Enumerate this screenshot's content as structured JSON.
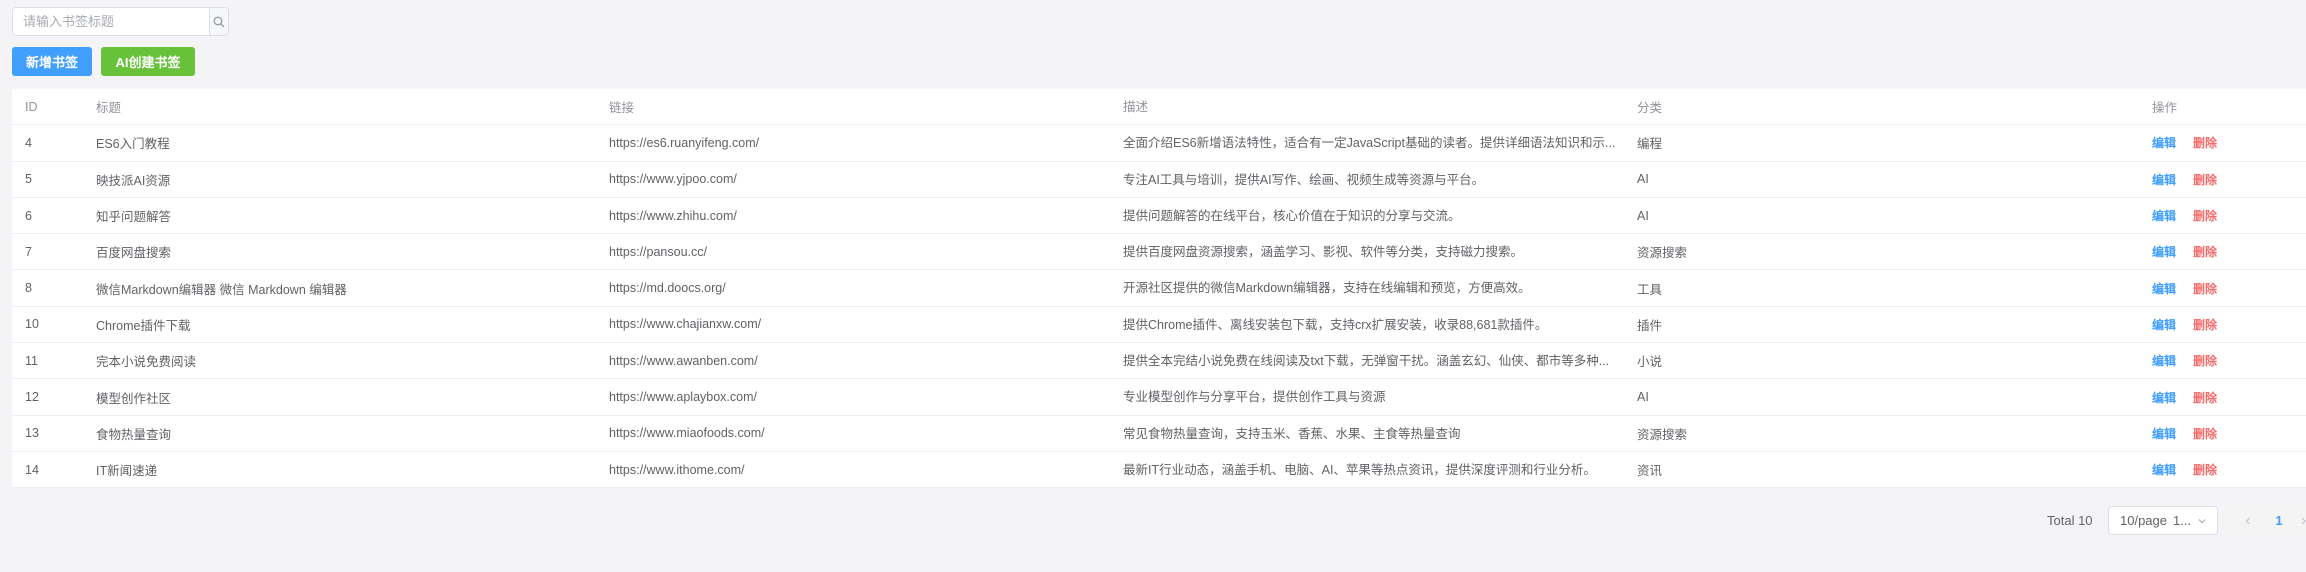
{
  "search": {
    "placeholder": "请输入书签标题",
    "value": ""
  },
  "toolbar": {
    "add_label": "新增书签",
    "ai_label": "AI创建书签"
  },
  "table": {
    "columns": [
      "ID",
      "标题",
      "链接",
      "描述",
      "分类",
      "操作"
    ],
    "rows": [
      {
        "id": "4",
        "title": "ES6入门教程",
        "link": "https://es6.ruanyifeng.com/",
        "desc": "全面介绍ES6新增语法特性，适合有一定JavaScript基础的读者。提供详细语法知识和示...",
        "category": "编程",
        "edit": "编辑",
        "delete": "删除"
      },
      {
        "id": "5",
        "title": "映技派AI资源",
        "link": "https://www.yjpoo.com/",
        "desc": "专注AI工具与培训，提供AI写作、绘画、视频生成等资源与平台。",
        "category": "AI",
        "edit": "编辑",
        "delete": "删除"
      },
      {
        "id": "6",
        "title": "知乎问题解答",
        "link": "https://www.zhihu.com/",
        "desc": "提供问题解答的在线平台，核心价值在于知识的分享与交流。",
        "category": "AI",
        "edit": "编辑",
        "delete": "删除"
      },
      {
        "id": "7",
        "title": "百度网盘搜索",
        "link": "https://pansou.cc/",
        "desc": "提供百度网盘资源搜索，涵盖学习、影视、软件等分类，支持磁力搜索。",
        "category": "资源搜索",
        "edit": "编辑",
        "delete": "删除"
      },
      {
        "id": "8",
        "title": "微信Markdown编辑器 微信 Markdown 编辑器",
        "link": "https://md.doocs.org/",
        "desc": "开源社区提供的微信Markdown编辑器，支持在线编辑和预览，方便高效。",
        "category": "工具",
        "edit": "编辑",
        "delete": "删除"
      },
      {
        "id": "10",
        "title": "Chrome插件下载",
        "link": "https://www.chajianxw.com/",
        "desc": "提供Chrome插件、离线安装包下载，支持crx扩展安装，收录88,681款插件。",
        "category": "插件",
        "edit": "编辑",
        "delete": "删除"
      },
      {
        "id": "11",
        "title": "完本小说免费阅读",
        "link": "https://www.awanben.com/",
        "desc": "提供全本完结小说免费在线阅读及txt下载，无弹窗干扰。涵盖玄幻、仙侠、都市等多种...",
        "category": "小说",
        "edit": "编辑",
        "delete": "删除"
      },
      {
        "id": "12",
        "title": "模型创作社区",
        "link": "https://www.aplaybox.com/",
        "desc": "专业模型创作与分享平台，提供创作工具与资源",
        "category": "AI",
        "edit": "编辑",
        "delete": "删除"
      },
      {
        "id": "13",
        "title": "食物热量查询",
        "link": "https://www.miaofoods.com/",
        "desc": "常见食物热量查询，支持玉米、香蕉、水果、主食等热量查询",
        "category": "资源搜索",
        "edit": "编辑",
        "delete": "删除"
      },
      {
        "id": "14",
        "title": "IT新闻速递",
        "link": "https://www.ithome.com/",
        "desc": "最新IT行业动态，涵盖手机、电脑、AI、苹果等热点资讯，提供深度评测和行业分析。",
        "category": "资讯",
        "edit": "编辑",
        "delete": "删除"
      }
    ]
  },
  "pagination": {
    "total_label": "Total 10",
    "page_size_label": "10/page",
    "page_size_suffix": "1...",
    "current_page": "1"
  },
  "icons": {
    "search": "search-icon",
    "dropdown": "chevron-down-icon",
    "prev": "chevron-left-icon",
    "next": "chevron-right-icon"
  },
  "colors": {
    "primary": "#409eff",
    "success": "#67c23a",
    "danger": "#f56c6c",
    "background": "#f4f4f6"
  }
}
